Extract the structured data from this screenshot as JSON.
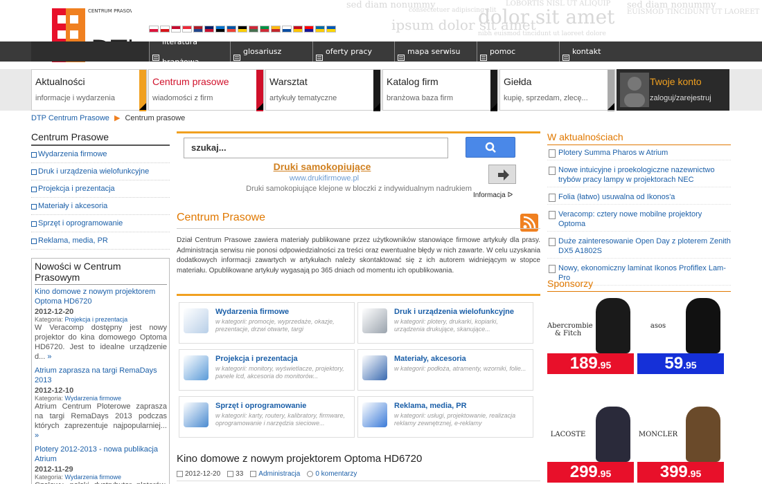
{
  "header": {
    "logo_text": "DTP",
    "logo_sub": "CENTRUM PRASOWE",
    "bg_words": [
      "sed diam nonummy",
      "consectetuer adipiscing elit",
      "LOBORTIS NISL UT ALIQUIP",
      "sed diam nonummy",
      "dolor sit amet",
      "EUISMOD TINCIDUNT UT LAOREET DOLORE",
      "ipsum dolor sit amet",
      "nibh euismod tincidunt ut laoreet dolore"
    ],
    "flags": [
      {
        "name": "pl-flag",
        "colors": [
          "#ffffff",
          "#dc143c"
        ]
      },
      {
        "name": "cz-flag",
        "colors": [
          "#ffffff",
          "#d7141a"
        ]
      },
      {
        "name": "dk-flag",
        "colors": [
          "#c60c30",
          "#ffffff"
        ]
      },
      {
        "name": "at-flag",
        "colors": [
          "#ed2939",
          "#ffffff"
        ]
      },
      {
        "name": "nl-flag",
        "colors": [
          "#ae1c28",
          "#21468b"
        ]
      },
      {
        "name": "gb-flag",
        "colors": [
          "#012169",
          "#c8102e"
        ]
      },
      {
        "name": "ee-flag",
        "colors": [
          "#0072ce",
          "#000000"
        ]
      },
      {
        "name": "fr-flag",
        "colors": [
          "#0055a4",
          "#ef4135"
        ]
      },
      {
        "name": "de-flag",
        "colors": [
          "#000000",
          "#ffce00"
        ]
      },
      {
        "name": "hu-flag",
        "colors": [
          "#ce2939",
          "#477050"
        ]
      },
      {
        "name": "it-flag",
        "colors": [
          "#009246",
          "#ce2b37"
        ]
      },
      {
        "name": "lt-flag",
        "colors": [
          "#fdb913",
          "#c1272d"
        ]
      },
      {
        "name": "sk-flag",
        "colors": [
          "#ffffff",
          "#0b4ea2"
        ]
      },
      {
        "name": "es-flag",
        "colors": [
          "#c60b1e",
          "#ffc400"
        ]
      },
      {
        "name": "hr-flag",
        "colors": [
          "#ff0000",
          "#171796"
        ]
      },
      {
        "name": "se-flag",
        "colors": [
          "#006aa7",
          "#fecc00"
        ]
      },
      {
        "name": "ua-flag",
        "colors": [
          "#0057b7",
          "#ffd700"
        ]
      }
    ]
  },
  "nav": [
    {
      "label": "literatura branżowa",
      "icon": "book-icon"
    },
    {
      "label": "glosariusz",
      "icon": "glossary-icon"
    },
    {
      "label": "oferty pracy",
      "icon": "jobs-icon"
    },
    {
      "label": "mapa serwisu",
      "icon": "sitemap-icon"
    },
    {
      "label": "pomoc",
      "icon": "help-icon"
    },
    {
      "label": "kontakt",
      "icon": "mail-icon"
    }
  ],
  "tabs": [
    {
      "title": "Aktualności",
      "sub": "informacje i wydarzenia",
      "color": "#f0a020",
      "title_color": "#222"
    },
    {
      "title": "Centrum prasowe",
      "sub": "wiadomości z firm",
      "color": "#d0102a",
      "title_color": "#d0102a"
    },
    {
      "title": "Warsztat",
      "sub": "artykuły tematyczne",
      "color": "#1a1a1a",
      "title_color": "#222"
    },
    {
      "title": "Katalog firm",
      "sub": "branżowa baza firm",
      "color": "#1a1a1a",
      "title_color": "#222"
    },
    {
      "title": "Giełda",
      "sub": "kupię, sprzedam, zlecę...",
      "color": "#aaaaaa",
      "title_color": "#222"
    }
  ],
  "account": {
    "title": "Twoje konto",
    "sub": "zaloguj/zarejestruj"
  },
  "breadcrumb": {
    "root": "DTP Centrum Prasowe",
    "current": "Centrum prasowe"
  },
  "left": {
    "heading": "Centrum Prasowe",
    "categories": [
      "Wydarzenia firmowe",
      "Druk i urządzenia wielofunkcyjne",
      "Projekcja i prezentacja",
      "Materiały i akcesoria",
      "Sprzęt i oprogramowanie",
      "Reklama, media, PR"
    ],
    "news_heading": "Nowości w Centrum Prasowym",
    "news": [
      {
        "title": "Kino domowe z nowym projektorem Optoma HD6720",
        "date": "2012-12-20",
        "cat_label": "Kategoria:",
        "cat": "Projekcja i prezentacja",
        "excerpt": "W Veracomp dostępny jest nowy projektor do kina domowego Optoma HD6720. Jest to idealne urządzenie d...",
        "more": "»"
      },
      {
        "title": "Atrium zaprasza na targi RemaDays 2013",
        "date": "2012-12-10",
        "cat_label": "Kategoria:",
        "cat": "Wydarzenia firmowe",
        "excerpt": "Atrium Centrum Ploterowe zaprasza na targi RemaDays 2013 podczas których zaprezentuje najpopularniej...",
        "more": "»"
      },
      {
        "title": "Plotery 2012-2013 - nowa publikacja Atrium",
        "date": "2012-11-29",
        "cat_label": "Kategoria:",
        "cat": "Wydarzenia firmowe",
        "excerpt": "Czołowy, polski dystrybutor ploterów, firma Atrium Centrum Ploterowe po raz",
        "more": ""
      }
    ]
  },
  "ad": {
    "search_placeholder": "szukaj...",
    "title": "Druki samokopiujące",
    "url": "www.drukifirmowe.pl",
    "text": "Druki samokopiujące klejone w bloczki z indywidualnym nadrukiem",
    "info": "Informacja"
  },
  "main": {
    "title": "Centrum Prasowe",
    "description": "Dział Centrum Prasowe zawiera materiały publikowane przez użytkowników stanowiące firmowe artykuły dla prasy. Administracja serwisu nie ponosi odpowiedzialności za treści oraz ewentualne błędy w nich zawarte. W celu uzyskania dodatkowych informacji zawartych w artykułach należy skontaktować się z ich autorem widniejącym w stopce materiału. Opublikowane artykuły wygasają po 365 dniach od momentu ich opublikowania.",
    "grid": [
      {
        "title": "Wydarzenia firmowe",
        "desc": "w kategorii: promocje, wyprzedaże, okazje, prezentacje, drzwi otwarte, targi",
        "icon": "events-icon",
        "color": "#b8cfe8"
      },
      {
        "title": "Druk i urządzenia wielofunkcyjne",
        "desc": "w kategorii: plotery, drukarki, kopiarki, urządzenia drukujące, skanujące...",
        "icon": "printer-icon",
        "color": "#9aa3ad"
      },
      {
        "title": "Projekcja i prezentacja",
        "desc": "w kategorii: monitory, wyświetlacze, projektory, panele lcd, akcesoria do monitorów...",
        "icon": "monitor-icon",
        "color": "#5a9ad8"
      },
      {
        "title": "Materiały, akcesoria",
        "desc": "w kategorii: podłoża, atramenty, wzorniki, folie...",
        "icon": "paint-icon",
        "color": "#3a6ab0"
      },
      {
        "title": "Sprzęt i oprogramowanie",
        "desc": "w kategorii: karty, routery, kalibratory, firmware, oprogramowanie i narzędzia sieciowe...",
        "icon": "software-icon",
        "color": "#4a8ad0"
      },
      {
        "title": "Reklama, media, PR",
        "desc": "w kategorii: usługi, projektowanie, realizacja reklamy zewnętrznej, e-reklamy",
        "icon": "cube-icon",
        "color": "#3a7ad8"
      }
    ],
    "article": {
      "title": "Kino domowe z nowym projektorem Optoma HD6720",
      "date": "2012-12-20",
      "views": "33",
      "author": "Administracja",
      "comments": "0 komentarzy"
    }
  },
  "right": {
    "heading": "W aktualnościach",
    "items": [
      "Plotery Summa Pharos w Atrium",
      "Nowe intuicyjne i proekologiczne nazewnictwo trybów pracy lampy w projektorach NEC",
      "Folia (łatwo) usuwalna od Ikonos'a",
      "Veracomp: cztery nowe mobilne projektory Optoma",
      "Duże zainteresowanie Open Day z ploterem Zenith DX5 A1802S",
      "Nowy, ekonomiczny laminat Ikonos Profiflex Lam-Pro"
    ],
    "sponsors_heading": "Sponsorzy",
    "products": [
      {
        "brand": "Abercrombie & Fitch",
        "price_main": "189",
        "price_cents": ".95",
        "price_bg": "#e8102a"
      },
      {
        "brand": "asos",
        "price_main": "59",
        "price_cents": ".95",
        "price_bg": "#1530d8"
      },
      {
        "brand": "LACOSTE",
        "price_main": "299",
        "price_cents": ".95",
        "price_bg": "#e8102a"
      },
      {
        "brand": "MONCLER",
        "price_main": "399",
        "price_cents": ".95",
        "price_bg": "#e8102a"
      }
    ]
  }
}
